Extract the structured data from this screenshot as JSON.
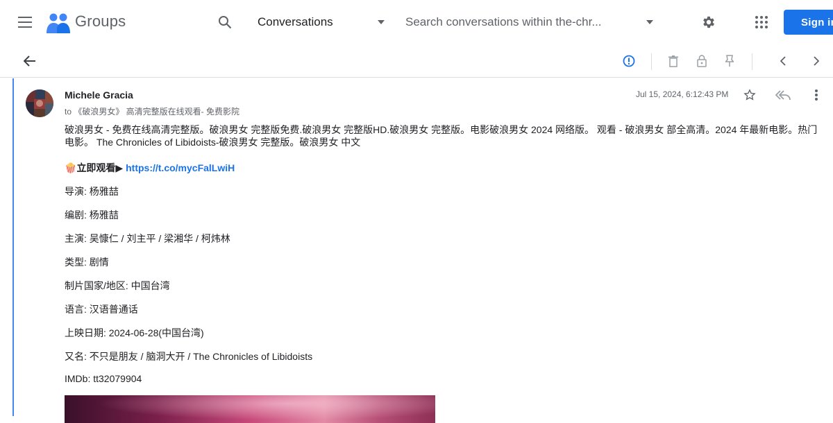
{
  "header": {
    "brand": "Groups",
    "scope_selected": "Conversations",
    "search_placeholder": "Search conversations within the-chr...",
    "signin_label": "Sign in"
  },
  "message": {
    "sender": "Michele Gracia",
    "recipient": "to 《破浪男女》 高清完整版在线观看- 免费影院",
    "timestamp": "Jul 15, 2024, 6:12:43 PM",
    "intro": "破浪男女 - 免费在线高清完整版。破浪男女 完整版免费.破浪男女 完整版HD.破浪男女 完整版。电影破浪男女 2024 网络版。 观看 - 破浪男女 部全高清。2024 年最新电影。热门电影。 The Chronicles of Libidoists-破浪男女 完整版。破浪男女 中文",
    "watch_emoji": "🍿",
    "watch_label": "立即观看▶",
    "watch_link": "https://t.co/mycFalLwiH",
    "details": [
      "导演: 杨雅喆",
      "编剧: 杨雅喆",
      "主演: 吴慷仁 / 刘主平 / 梁湘华 / 柯炜林",
      "类型: 剧情",
      "制片国家/地区: 中国台湾",
      "语言: 汉语普通话",
      "上映日期: 2024-06-28(中国台湾)",
      "又名: 不只是朋友 / 脑洞大开 / The Chronicles of Libidoists",
      "IMDb: tt32079904"
    ]
  },
  "colors": {
    "accent": "#1a73e8",
    "thread_border": "#4285f4",
    "info_icon": "#1a73e8"
  }
}
